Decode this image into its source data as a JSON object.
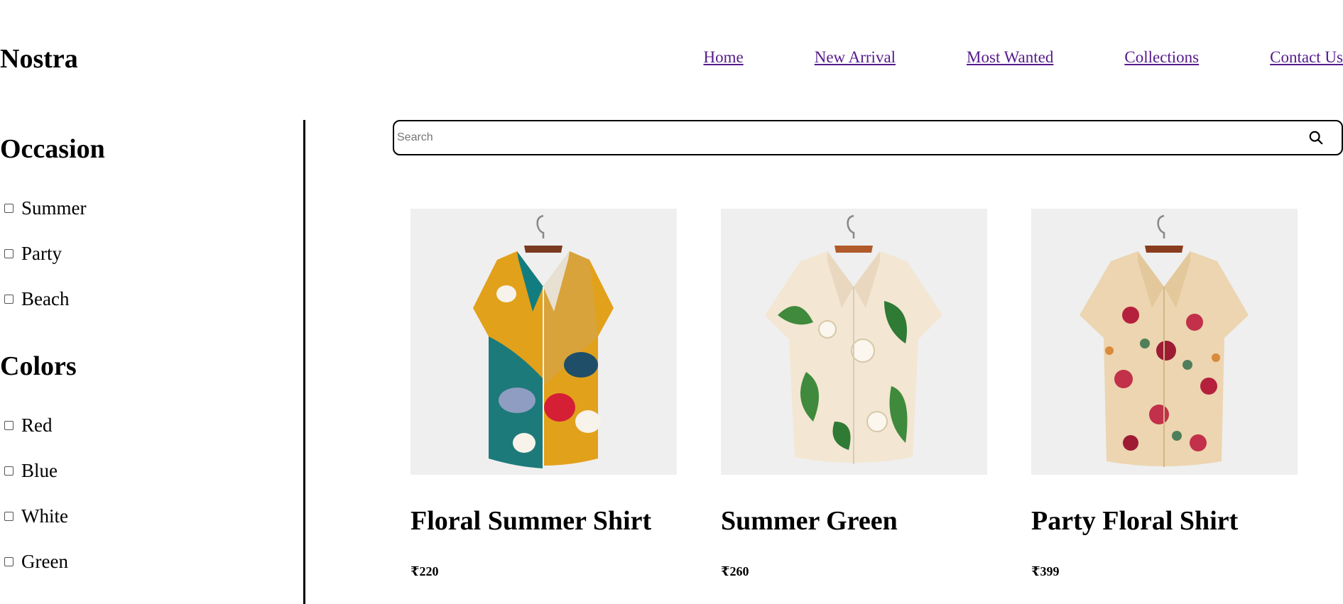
{
  "header": {
    "logo": "Nostra",
    "nav": [
      "Home",
      "New Arrival",
      "Most Wanted",
      "Collections",
      "Contact Us"
    ]
  },
  "sidebar": {
    "occasion": {
      "title": "Occasion",
      "options": [
        "Summer",
        "Party",
        "Beach"
      ]
    },
    "colors": {
      "title": "Colors",
      "options": [
        "Red",
        "Blue",
        "White",
        "Green"
      ]
    }
  },
  "search": {
    "placeholder": "Search",
    "icon": "search-icon"
  },
  "products": [
    {
      "title": "Floral Summer Shirt",
      "price": "₹220",
      "image": "shirt-multicolor-abstract-print"
    },
    {
      "title": "Summer Green",
      "price": "₹260",
      "image": "shirt-cream-green-floral"
    },
    {
      "title": "Party Floral Shirt",
      "price": "₹399",
      "image": "shirt-cream-red-floral"
    }
  ],
  "colors": {
    "link": "#551a8b",
    "thumb_bg": "#efefef",
    "text": "#000000"
  }
}
